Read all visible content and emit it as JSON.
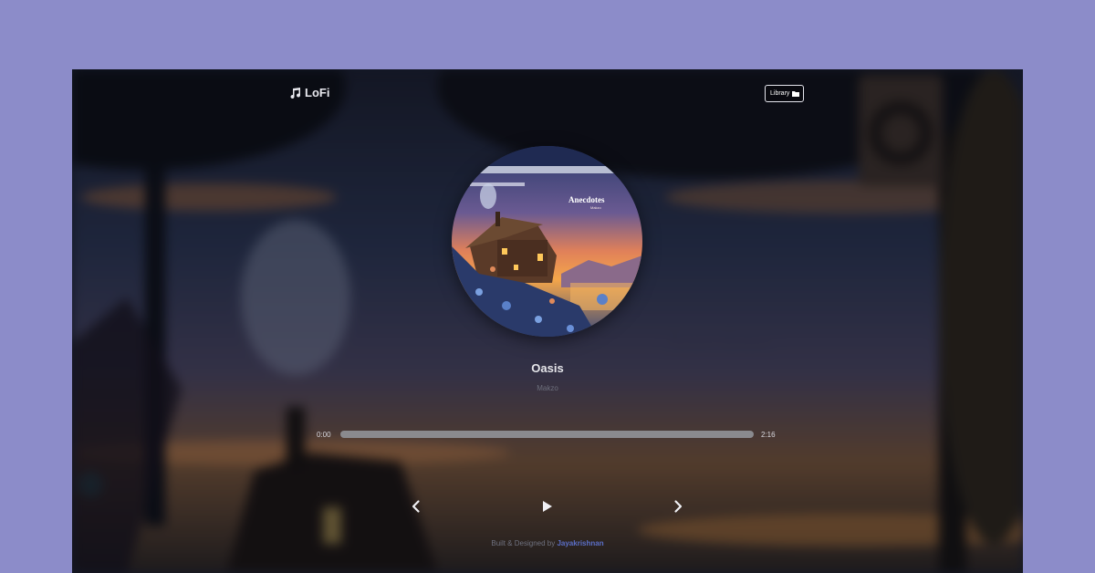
{
  "brand": {
    "icon": "music-notes-icon",
    "name": "LoFi"
  },
  "nav": {
    "library_label": "Library",
    "library_icon": "folder-icon"
  },
  "cover": {
    "album_title": "Anecdotes",
    "album_artist": "Makzo"
  },
  "track": {
    "title": "Oasis",
    "artist": "Makzo"
  },
  "player": {
    "current_time": "0:00",
    "total_time": "2:16",
    "progress": 0.0,
    "prev_icon": "chevron-left-icon",
    "play_icon": "play-icon",
    "next_icon": "chevron-right-icon"
  },
  "footer": {
    "text": "Built & Designed by",
    "author": "Jayakrishnan"
  },
  "colors": {
    "page_background": "#8c8cc9",
    "accent_link": "#5b6fc8",
    "progress_track": "#8a8a8e",
    "text_primary": "#e6e6ea"
  }
}
